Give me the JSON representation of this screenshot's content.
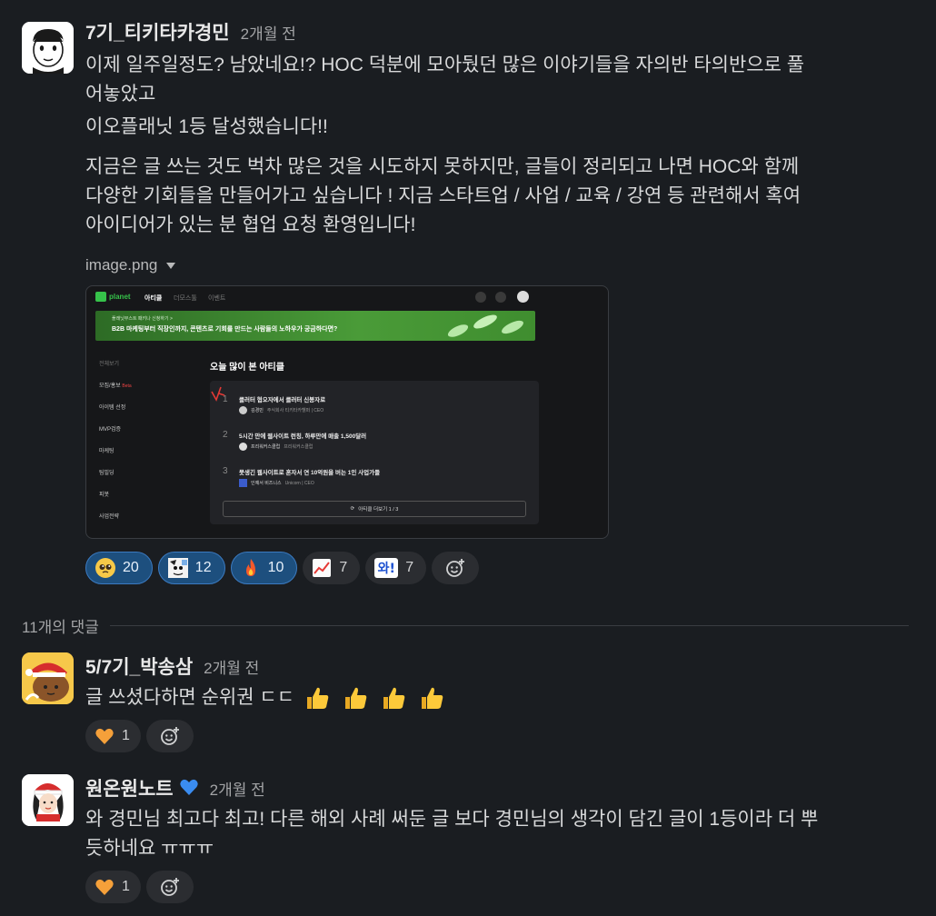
{
  "main_message": {
    "author": "7기_티키타카경민",
    "time": "2개월 전",
    "line1": "이제 일주일정도? 남았네요!? HOC 덕분에 모아뒀던 많은 이야기들을 자의반 타의반으로 풀",
    "line2": "어놓았고",
    "line3": "이오플래닛 1등 달성했습니다!!",
    "para2_line1": "지금은 글 쓰는 것도 벅차 많은 것을 시도하지 못하지만, 글들이 정리되고 나면 HOC와 함께",
    "para2_line2": "다양한 기회들을 만들어가고 싶습니다 ! 지금 스타트업 / 사업 / 교육 / 강연 등 관련해서 혹여",
    "para2_line3": "아이디어가 있는 분 협업 요청 환영입니다!",
    "file_name": "image.png",
    "screenshot": {
      "logo": "planet",
      "nav": [
        "아티클",
        "더모스툴",
        "이벤트"
      ],
      "banner_small": "플래닛부스트 패키나 신청하기 >",
      "banner": "B2B 마케팅부터 직장인까지, 콘텐츠로 기회를 만드는 사람들의 노하우가 궁금하다면?",
      "sidebar": [
        "전체보기",
        "모집/홍보",
        "아이템 선정",
        "MVP검증",
        "마케팅",
        "팀빌딩",
        "피봇",
        "사업전략"
      ],
      "beta": "Beta",
      "section_title": "오늘 많이 본 아티클",
      "articles": [
        {
          "rank": "1",
          "title": "클러터 협오자에서 클러터 신봉자로",
          "author": "김경민",
          "meta": "주식회사 티키타카헬퍼 | CEO"
        },
        {
          "rank": "2",
          "title": "5시간 만에 웹사이트 런칭, 하루만에 매출 1,500달러",
          "author": "프리워커스클럽",
          "meta": "프리워커스클럽"
        },
        {
          "rank": "3",
          "title": "못생긴 웹사이트로 혼자서 연 10억원을 버는 1인 사업가들",
          "author": "인예서 비즈니스",
          "meta": "Unicorn | CEO"
        }
      ],
      "more_button": "아티클 더보기 1 / 3"
    },
    "reactions": [
      {
        "icon": "pleading-face-icon",
        "count": "20",
        "active": true
      },
      {
        "icon": "custom-face-icon",
        "count": "12",
        "active": true
      },
      {
        "icon": "fire-icon",
        "count": "10",
        "active": true
      },
      {
        "icon": "chart-up-icon",
        "count": "7",
        "active": false
      },
      {
        "icon": "wow-icon",
        "count": "7",
        "active": false
      }
    ],
    "wow_text": "와!"
  },
  "thread": {
    "count_label": "11개의 댓글"
  },
  "replies": [
    {
      "author": "5/7기_박송삼",
      "time": "2개월 전",
      "text": "글 쓰셨다하면 순위권 ㄷㄷ",
      "reaction_count": "1"
    },
    {
      "author": "원온원노트",
      "time": "2개월 전",
      "line1": "와 경민님 최고다 최고! 다른 해외 사례 써둔 글 보다 경민님의 생각이 담긴 글이 1등이라 더 뿌",
      "line2": "듯하네요 ㅠㅠㅠ",
      "reaction_count": "1",
      "avatar_label": "원온원노트"
    }
  ],
  "colors": {
    "background": "#1a1d21",
    "reaction_active": "#1d4f7e",
    "reaction_inactive": "#2b2d31",
    "banner_green": "#3f8d2f"
  }
}
